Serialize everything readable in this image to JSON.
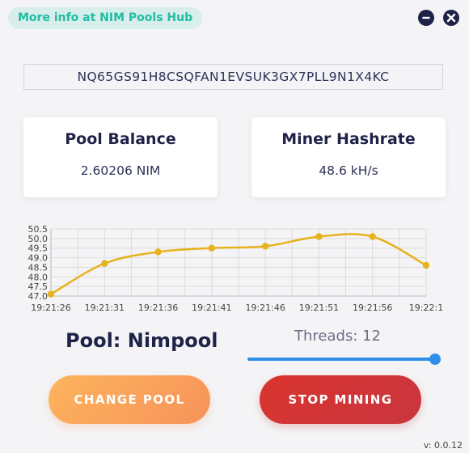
{
  "header": {
    "hub_link_label": "More info at NIM Pools Hub",
    "minimize_icon": "minus-icon",
    "close_icon": "close-icon"
  },
  "address": "NQ65GS91H8CSQFAN1EVSUK3GX7PLL9N1X4KC",
  "cards": {
    "pool_balance": {
      "title": "Pool Balance",
      "value": "2.60206 NIM"
    },
    "miner_hashrate": {
      "title": "Miner Hashrate",
      "value": "48.6 kH/s"
    }
  },
  "chart_data": {
    "type": "line",
    "categories": [
      "19:21:26",
      "19:21:31",
      "19:21:36",
      "19:21:41",
      "19:21:46",
      "19:21:51",
      "19:21:56",
      "19:22:1"
    ],
    "values": [
      47.1,
      48.7,
      49.3,
      49.5,
      49.6,
      50.1,
      50.1,
      48.6
    ],
    "y_ticks": [
      "47.0",
      "47.5",
      "48.0",
      "48.5",
      "49.0",
      "49.5",
      "50.0",
      "50.5"
    ],
    "ylim": [
      47.0,
      50.5
    ],
    "grid": true,
    "line_color": "#e6b21e"
  },
  "pool": {
    "label": "Pool: Nimpool"
  },
  "threads": {
    "label": "Threads: 12",
    "value": 12,
    "max": 12,
    "accent": "#2f8fe8"
  },
  "buttons": {
    "change_pool": "CHANGE POOL",
    "stop_mining": "STOP MINING"
  },
  "version": "v: 0.0.12"
}
